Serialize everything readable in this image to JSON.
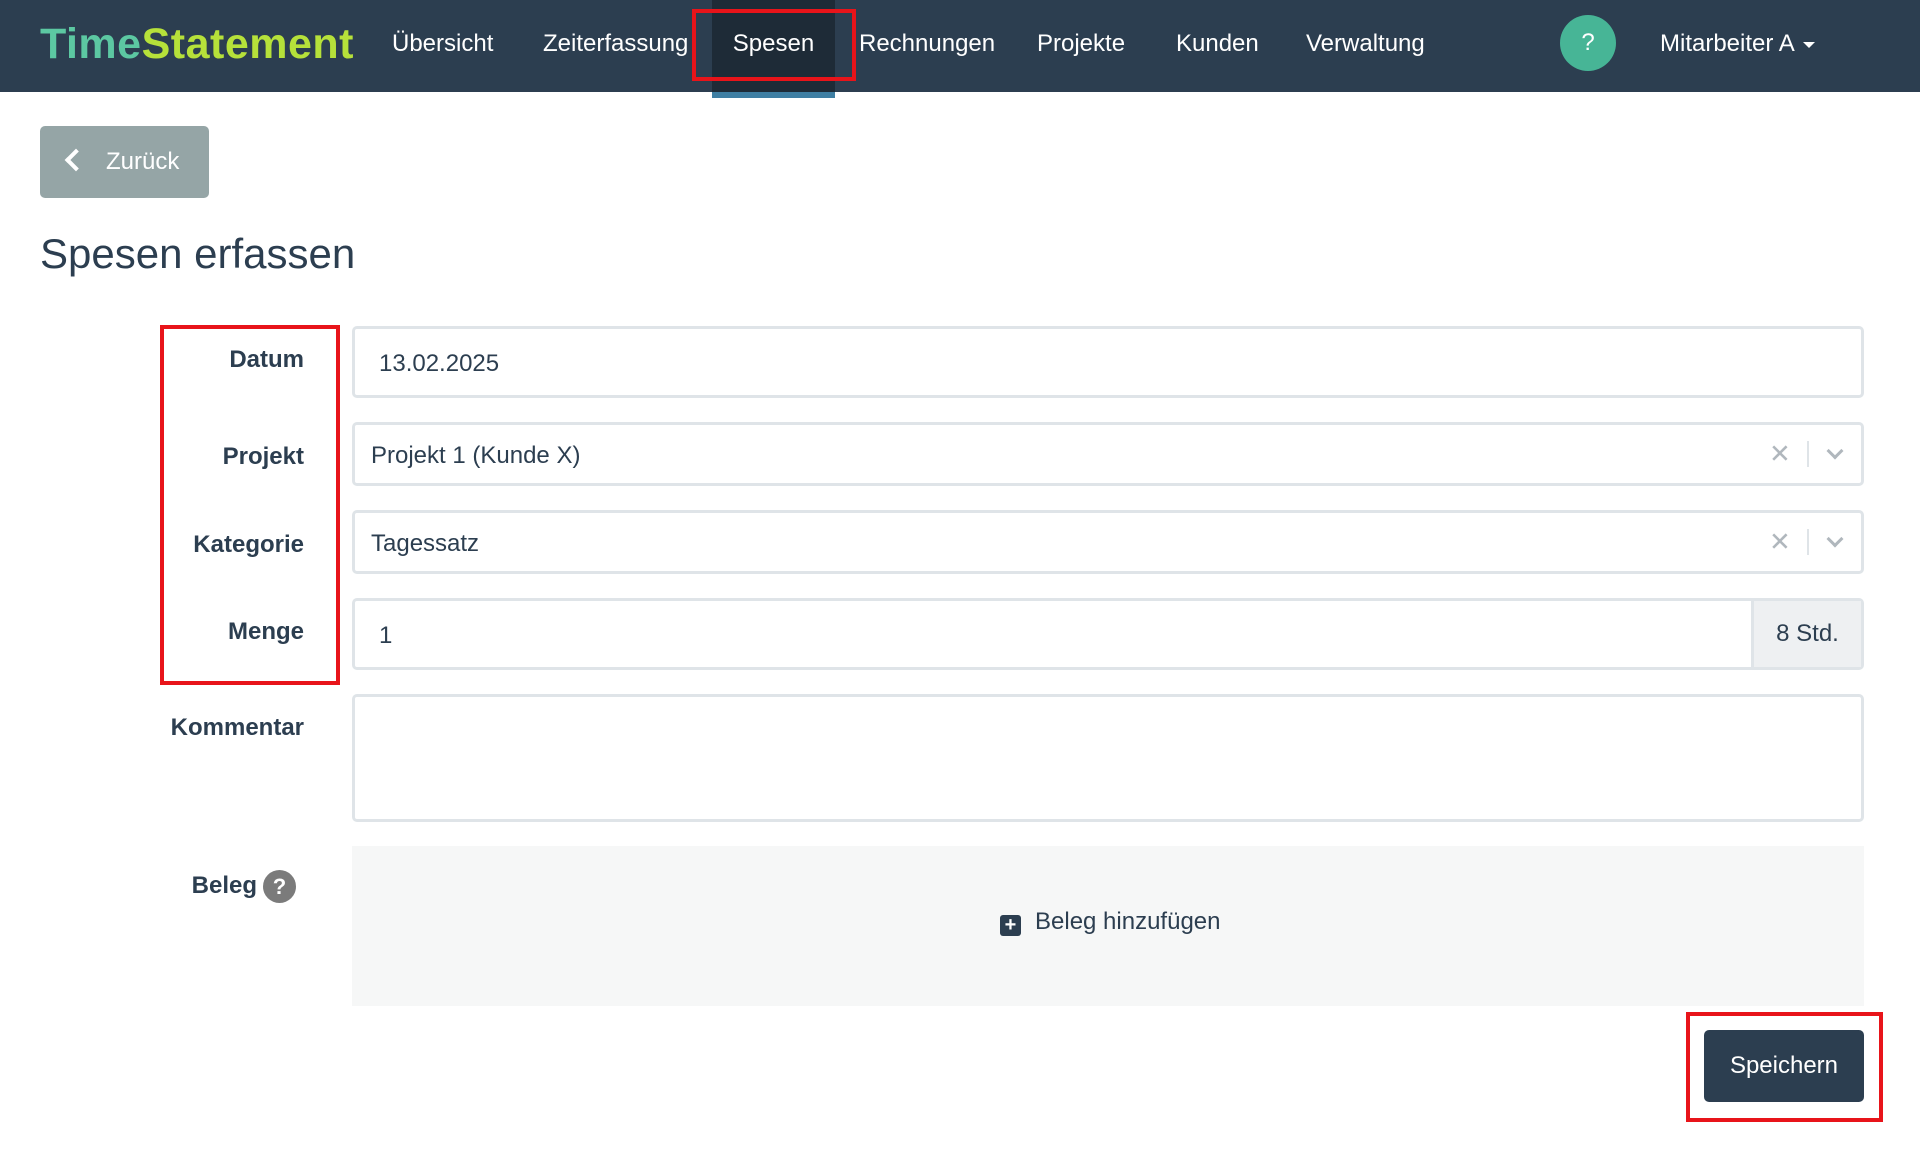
{
  "brand": {
    "part1": "Time",
    "part2": "Statement"
  },
  "nav": {
    "items": [
      {
        "label": "Übersicht"
      },
      {
        "label": "Zeiterfassung"
      },
      {
        "label": "Spesen",
        "active": true
      },
      {
        "label": "Rechnungen"
      },
      {
        "label": "Projekte"
      },
      {
        "label": "Kunden"
      },
      {
        "label": "Verwaltung"
      }
    ],
    "help": "?",
    "user": "Mitarbeiter A"
  },
  "back_label": "Zurück",
  "page_title": "Spesen erfassen",
  "form": {
    "datum": {
      "label": "Datum",
      "value": "13.02.2025"
    },
    "projekt": {
      "label": "Projekt",
      "value": "Projekt 1 (Kunde X)"
    },
    "kategorie": {
      "label": "Kategorie",
      "value": "Tagessatz"
    },
    "menge": {
      "label": "Menge",
      "value": "1",
      "unit": "8 Std."
    },
    "kommentar": {
      "label": "Kommentar",
      "value": ""
    },
    "beleg": {
      "label": "Beleg",
      "help": "?",
      "add_label": "Beleg hinzufügen"
    },
    "save_label": "Speichern"
  },
  "colors": {
    "navbar": "#2c3e50",
    "brand_time": "#5cc8a2",
    "brand_statement": "#b6e13a",
    "help_circle": "#47b596",
    "highlight": "#e8141a",
    "back_button": "#95a5a6"
  }
}
